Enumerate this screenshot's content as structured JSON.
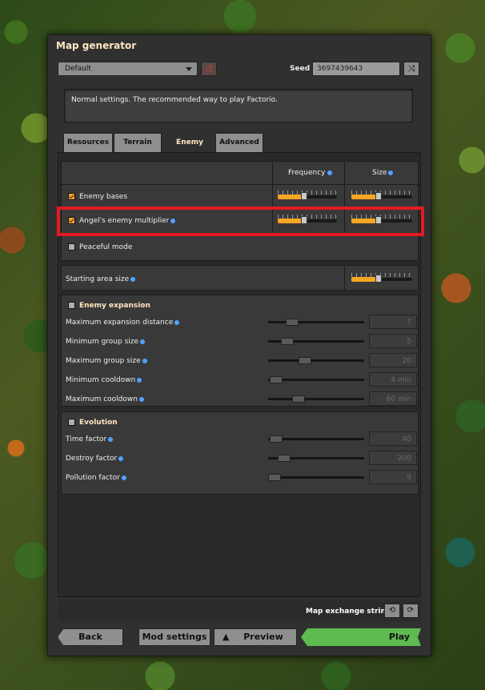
{
  "window_title": "Map generator",
  "preset": {
    "selected": "Default"
  },
  "seed": {
    "label": "Seed",
    "value": "3697439643"
  },
  "description": "Normal settings. The recommended way to play Factorio.",
  "tabs": [
    {
      "label": "Resources"
    },
    {
      "label": "Terrain"
    },
    {
      "label": "Enemy",
      "active": true
    },
    {
      "label": "Advanced"
    }
  ],
  "enemy_table": {
    "col_frequency": "Frequency",
    "col_size": "Size",
    "rows": [
      {
        "label": "Enemy bases",
        "checked": true,
        "frequency_level": 0.45,
        "size_level": 0.45
      },
      {
        "label": "Angel's enemy multiplier",
        "checked": true,
        "frequency_level": 0.45,
        "size_level": 0.45
      }
    ],
    "peaceful": {
      "label": "Peaceful mode",
      "checked": false
    },
    "starting_area": {
      "label": "Starting area size",
      "level": 0.45
    }
  },
  "expansion": {
    "title": "Enemy expansion",
    "checked": false,
    "rows": [
      {
        "label": "Maximum expansion distance",
        "value": "7",
        "level": 0.2
      },
      {
        "label": "Minimum group size",
        "value": "5",
        "level": 0.15
      },
      {
        "label": "Maximum group size",
        "value": "20",
        "level": 0.32
      },
      {
        "label": "Minimum cooldown",
        "value": "4 min",
        "level": 0.03
      },
      {
        "label": "Maximum cooldown",
        "value": "60 min",
        "level": 0.25
      }
    ]
  },
  "evolution": {
    "title": "Evolution",
    "checked": false,
    "rows": [
      {
        "label": "Time factor",
        "value": "40",
        "level": 0.03
      },
      {
        "label": "Destroy factor",
        "value": "200",
        "level": 0.12
      },
      {
        "label": "Pollution factor",
        "value": "9",
        "level": 0.01
      }
    ]
  },
  "footer": {
    "map_exchange_label": "Map exchange string",
    "back": "Back",
    "mod_settings": "Mod settings",
    "preview": "Preview",
    "play": "Play"
  },
  "colors": {
    "accent": "#f5a623",
    "play": "#5ebb4f",
    "highlight": "#e21b22"
  }
}
